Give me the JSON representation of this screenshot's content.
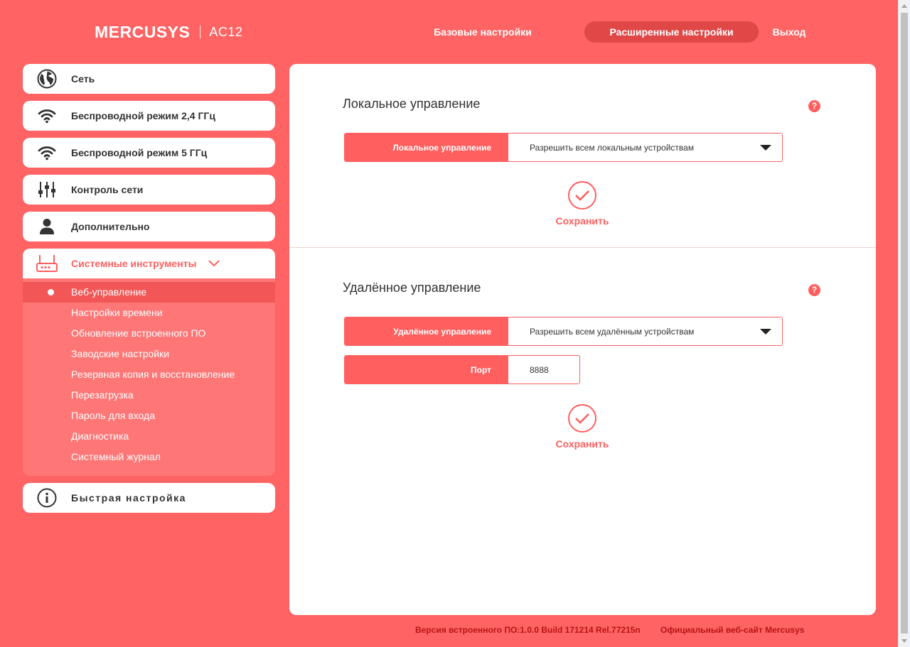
{
  "header": {
    "brand": "MERCUSYS",
    "model": "AC12",
    "nav": {
      "basic": "Базовые настройки",
      "advanced": "Расширенные настройки",
      "logout": "Выход"
    }
  },
  "sidebar": {
    "items": [
      {
        "label": "Сеть",
        "icon": "globe-icon"
      },
      {
        "label": "Беспроводной режим 2,4 ГГц",
        "icon": "wifi-icon"
      },
      {
        "label": "Беспроводной режим 5 ГГц",
        "icon": "wifi-icon"
      },
      {
        "label": "Контроль сети",
        "icon": "sliders-icon"
      },
      {
        "label": "Дополнительно",
        "icon": "user-icon"
      },
      {
        "label": "Системные инструменты",
        "icon": "router-icon"
      }
    ],
    "submenu": [
      "Веб-управление",
      "Настройки времени",
      "Обновление встроенного ПО",
      "Заводские настройки",
      "Резервная копия и восстановление",
      "Перезагрузка",
      "Пароль для входа",
      "Диагностика",
      "Системный журнал"
    ],
    "quick_setup": "Быстрая настройка"
  },
  "local": {
    "title": "Локальное управление",
    "field_label": "Локальное управление",
    "field_value": "Разрешить всем локальным устройствам",
    "save": "Сохранить"
  },
  "remote": {
    "title": "Удалённое управление",
    "field_label": "Удалённое управление",
    "field_value": "Разрешить всем удалённым устройствам",
    "port_label": "Порт",
    "port_value": "8888",
    "save": "Сохранить"
  },
  "help": "?",
  "footer": {
    "version": "Версия встроенного ПО:1.0.0 Build 171214 Rel.77215n",
    "site": "Официальный веб-сайт Mercusys"
  },
  "colors": {
    "background": "#ff6363",
    "accent": "#ff5f5f",
    "submenu": "#ff7676",
    "selected": "#f25656",
    "footer_text": "#b81414"
  }
}
